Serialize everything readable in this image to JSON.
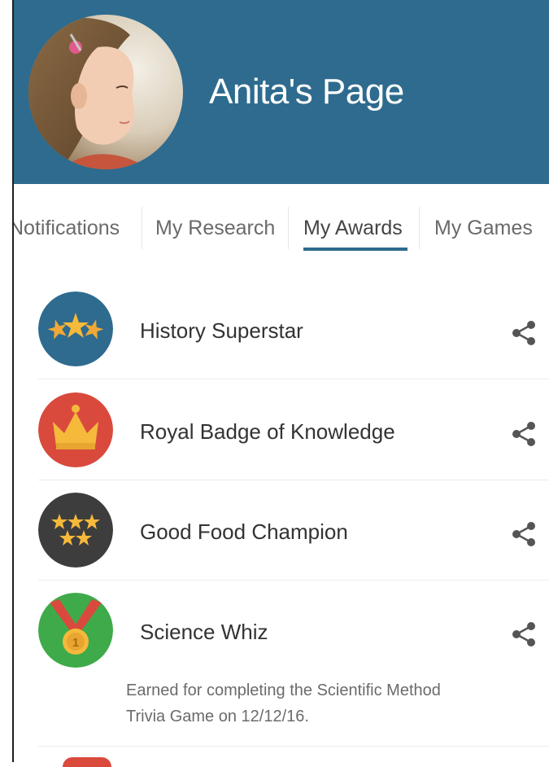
{
  "header": {
    "title": "Anita's Page",
    "avatar_alt": "profile photo",
    "background_color": "#2e6b8e"
  },
  "tabs": [
    {
      "label": "Notifications",
      "active": false
    },
    {
      "label": "My Research",
      "active": false
    },
    {
      "label": "My Awards",
      "active": true
    },
    {
      "label": "My Games",
      "active": false
    }
  ],
  "awards": [
    {
      "name": "History Superstar",
      "icon": "three-stars-icon",
      "color": "#2e6b8e"
    },
    {
      "name": "Royal Badge of Knowledge",
      "icon": "crown-icon",
      "color": "#d94a3d"
    },
    {
      "name": "Good Food Champion",
      "icon": "five-stars-icon",
      "color": "#3d3d3d"
    },
    {
      "name": "Science Whiz",
      "icon": "medal-icon",
      "color": "#3faa4a",
      "description": "Earned for completing the Scientific Method Trivia Game on 12/12/16."
    }
  ],
  "share_icon": "share-icon",
  "accent_color": "#2e6b8e",
  "star_color": "#f5b93b"
}
